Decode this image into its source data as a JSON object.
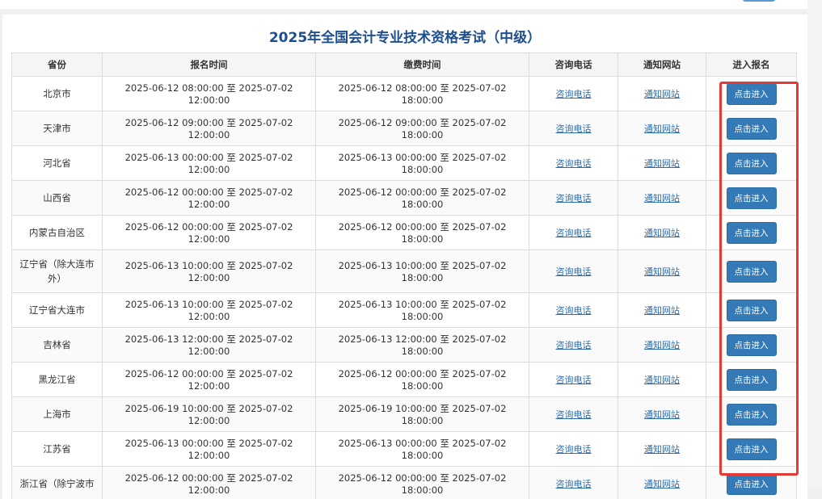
{
  "page": {
    "title": "2025年全国会计专业技术资格考试（中级）"
  },
  "table": {
    "headers": {
      "province": "省份",
      "register_time": "报名时间",
      "payment_time": "缴费时间",
      "phone": "咨询电话",
      "notice": "通知网站",
      "enter": "进入报名"
    },
    "rows": [
      {
        "province": "北京市",
        "register": "2025-06-12 08:00:00 至 2025-07-02 12:00:00",
        "payment": "2025-06-12 08:00:00 至 2025-07-02 18:00:00",
        "phone": "咨询电话",
        "notice": "通知网站",
        "enter": "点击进入"
      },
      {
        "province": "天津市",
        "register": "2025-06-12 09:00:00 至 2025-07-02 12:00:00",
        "payment": "2025-06-12 09:00:00 至 2025-07-02 18:00:00",
        "phone": "咨询电话",
        "notice": "通知网站",
        "enter": "点击进入"
      },
      {
        "province": "河北省",
        "register": "2025-06-13 00:00:00 至 2025-07-02 12:00:00",
        "payment": "2025-06-13 00:00:00 至 2025-07-02 18:00:00",
        "phone": "咨询电话",
        "notice": "通知网站",
        "enter": "点击进入"
      },
      {
        "province": "山西省",
        "register": "2025-06-12 00:00:00 至 2025-07-02 12:00:00",
        "payment": "2025-06-12 00:00:00 至 2025-07-02 18:00:00",
        "phone": "咨询电话",
        "notice": "通知网站",
        "enter": "点击进入"
      },
      {
        "province": "内蒙古自治区",
        "register": "2025-06-12 00:00:00 至 2025-07-02 12:00:00",
        "payment": "2025-06-12 00:00:00 至 2025-07-02 18:00:00",
        "phone": "咨询电话",
        "notice": "通知网站",
        "enter": "点击进入"
      },
      {
        "province": "辽宁省（除大连市外）",
        "register": "2025-06-13 10:00:00 至 2025-07-02 12:00:00",
        "payment": "2025-06-13 10:00:00 至 2025-07-02 18:00:00",
        "phone": "咨询电话",
        "notice": "通知网站",
        "enter": "点击进入"
      },
      {
        "province": "辽宁省大连市",
        "register": "2025-06-13 10:00:00 至 2025-07-02 12:00:00",
        "payment": "2025-06-13 10:00:00 至 2025-07-02 18:00:00",
        "phone": "咨询电话",
        "notice": "通知网站",
        "enter": "点击进入"
      },
      {
        "province": "吉林省",
        "register": "2025-06-13 12:00:00 至 2025-07-02 12:00:00",
        "payment": "2025-06-13 12:00:00 至 2025-07-02 18:00:00",
        "phone": "咨询电话",
        "notice": "通知网站",
        "enter": "点击进入"
      },
      {
        "province": "黑龙江省",
        "register": "2025-06-12 00:00:00 至 2025-07-02 12:00:00",
        "payment": "2025-06-12 00:00:00 至 2025-07-02 18:00:00",
        "phone": "咨询电话",
        "notice": "通知网站",
        "enter": "点击进入"
      },
      {
        "province": "上海市",
        "register": "2025-06-19 10:00:00 至 2025-07-02 12:00:00",
        "payment": "2025-06-19 10:00:00 至 2025-07-02 18:00:00",
        "phone": "咨询电话",
        "notice": "通知网站",
        "enter": "点击进入"
      },
      {
        "province": "江苏省",
        "register": "2025-06-13 00:00:00 至 2025-07-02 12:00:00",
        "payment": "2025-06-13 00:00:00 至 2025-07-02 18:00:00",
        "phone": "咨询电话",
        "notice": "通知网站",
        "enter": "点击进入"
      },
      {
        "province": "浙江省（除宁波市",
        "register": "2025-06-12 00:00:00 至 2025-07-02 12:00:00",
        "payment": "2025-06-12 00:00:00 至 2025-07-02 18:00:00",
        "phone": "咨询电话",
        "notice": "通知网站",
        "enter": "点击进入"
      }
    ]
  },
  "colors": {
    "title": "#1f4e8c",
    "button": "#337ab7",
    "link": "#2b6cb0",
    "highlight_box": "#e53935"
  }
}
